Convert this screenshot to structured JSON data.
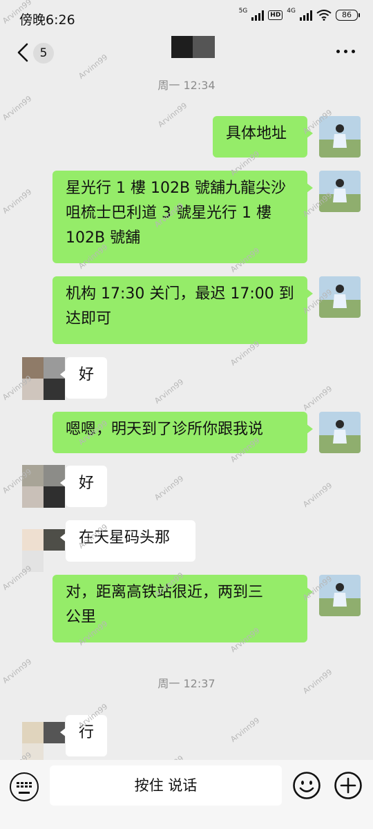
{
  "status_bar": {
    "time": "傍晚6:26",
    "net1": "5G",
    "hd": "HD",
    "net2": "4G",
    "battery": "86"
  },
  "nav": {
    "unread_count": "5",
    "back_icon": "chevron-left-icon",
    "more_icon": "more-dots-icon"
  },
  "chat": {
    "timestamp_1": "周一 12:34",
    "timestamp_2": "周一 12:37",
    "messages": [
      {
        "from": "me",
        "text": "具体地址"
      },
      {
        "from": "me",
        "lines": [
          "星光行 1 樓 102B 號舖九龍尖沙",
          "咀梳士巴利道 3 號星光行 1 樓",
          "102B 號舖"
        ]
      },
      {
        "from": "me",
        "lines": [
          "机构 17:30 关门，最迟 17:00 到",
          "达即可"
        ]
      },
      {
        "from": "them",
        "text": "好"
      },
      {
        "from": "me",
        "text": "嗯嗯，明天到了诊所你跟我说"
      },
      {
        "from": "them",
        "text": "好"
      },
      {
        "from": "them",
        "text": "在天星码头那"
      },
      {
        "from": "me",
        "lines": [
          "对，距离高铁站很近，两到三",
          "公里"
        ]
      },
      {
        "from": "them",
        "text": "行"
      }
    ]
  },
  "watermark": "Arvinn99",
  "input_bar": {
    "voice_label": "按住 说话",
    "keyboard_icon": "keyboard-icon",
    "emoji_icon": "emoji-icon",
    "plus_icon": "plus-icon"
  },
  "colors": {
    "my_bubble": "#95ec69",
    "their_bubble": "#ffffff",
    "background": "#ededed"
  }
}
